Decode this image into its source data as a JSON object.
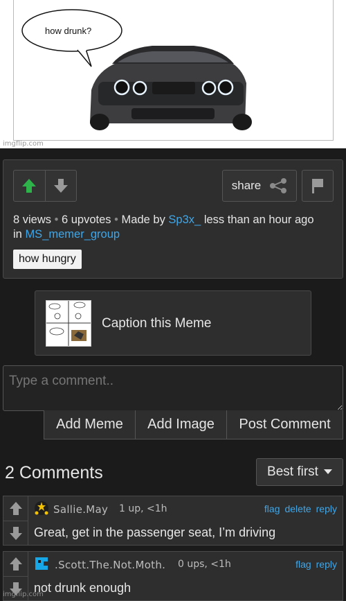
{
  "meme": {
    "speech": "how drunk?",
    "watermark": "imgflip.com"
  },
  "post": {
    "share_label": "share",
    "views": "8 views",
    "upvotes": "6 upvotes",
    "made_by": "Made by",
    "author": "Sp3x_",
    "time": "less than an hour ago",
    "in": "in",
    "group": "MS_memer_group",
    "tag": "how hungry"
  },
  "caption": {
    "label": "Caption this Meme"
  },
  "comment_box": {
    "placeholder": "Type a comment..",
    "add_meme": "Add Meme",
    "add_image": "Add Image",
    "post_comment": "Post Comment"
  },
  "comments": {
    "title": "2 Comments",
    "sort": "Best first",
    "items": [
      {
        "user": "Sallie.May",
        "stats": "1 up, <1h",
        "flag": "flag",
        "delete": "delete",
        "reply": "reply",
        "text": "Great, get in the passenger seat, I’m driving"
      },
      {
        "user": ".Scott.The.Not.Moth.",
        "stats": "0 ups, <1h",
        "flag": "flag",
        "reply": "reply",
        "text": "not drunk enough"
      }
    ]
  },
  "footer": {
    "watermark": "imgflip.com"
  },
  "colors": {
    "accent_link": "#3fa7e9",
    "upvote_active": "#2db34a",
    "panel_bg": "#2e2e2e",
    "page_bg": "#1b1b1b"
  }
}
